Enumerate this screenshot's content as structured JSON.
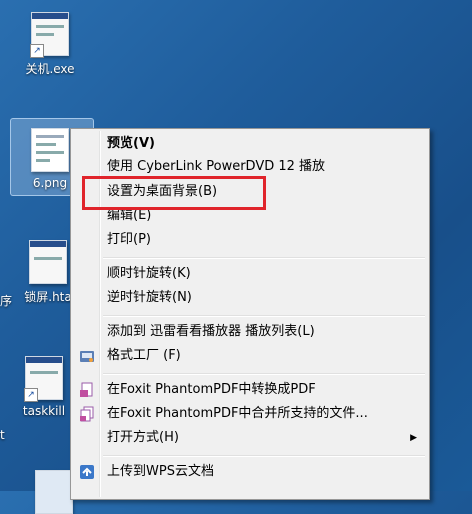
{
  "desktop": {
    "icons": [
      {
        "label": "关机.exe"
      },
      {
        "label": "6.png"
      },
      {
        "label": "锁屏.hta"
      },
      {
        "label": "taskkill"
      }
    ],
    "edge_chars": [
      "序",
      "t"
    ]
  },
  "context_menu": {
    "items": [
      {
        "label": "预览(V)",
        "bold": true
      },
      {
        "label": "使用 CyberLink PowerDVD 12 播放"
      },
      {
        "label": "设置为桌面背景(B)"
      },
      {
        "label": "编辑(E)"
      },
      {
        "label": "打印(P)"
      },
      {
        "label": "顺时针旋转(K)"
      },
      {
        "label": "逆时针旋转(N)"
      },
      {
        "label": "添加到 迅雷看看播放器 播放列表(L)"
      },
      {
        "label": "格式工厂 (F)",
        "icon": "format-factory-icon"
      },
      {
        "label": "在Foxit PhantomPDF中转换成PDF",
        "icon": "foxit-pdf-icon"
      },
      {
        "label": "在Foxit PhantomPDF中合并所支持的文件...",
        "icon": "foxit-merge-icon"
      },
      {
        "label": "打开方式(H)",
        "submenu_arrow": "▶"
      },
      {
        "label": "上传到WPS云文档",
        "icon": "wps-cloud-icon"
      }
    ]
  },
  "colors": {
    "highlight_box": "#e0242b",
    "desktop_bg": "#1f5d9c",
    "menu_bg": "#f0f0f0"
  }
}
